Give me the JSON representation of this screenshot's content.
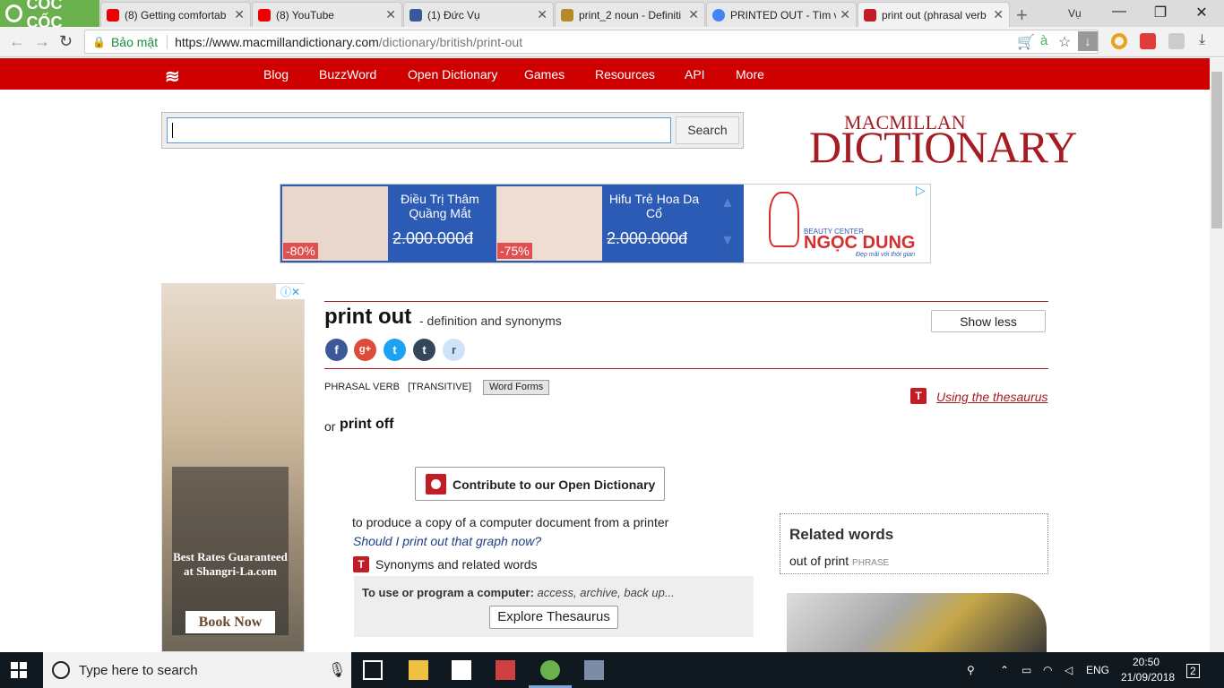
{
  "browser": {
    "brand": "CỐC CỐC",
    "tabs": [
      {
        "title": "(8) Getting comfortab",
        "favicon": "youtube-icon"
      },
      {
        "title": "(8) YouTube",
        "favicon": "youtube-icon"
      },
      {
        "title": "(1) Đức Vụ",
        "favicon": "facebook-icon"
      },
      {
        "title": "print_2 noun - Definiti",
        "favicon": "dictionary-icon"
      },
      {
        "title": "PRINTED OUT - Tìm vớ",
        "favicon": "google-icon"
      },
      {
        "title": "print out (phrasal verb",
        "favicon": "macmillan-icon"
      }
    ],
    "profile": "Vụ",
    "secure_label": "Bảo mật",
    "url_host": "https://www.macmillandictionary.com",
    "url_path": "/dictionary/british/print-out"
  },
  "site": {
    "nav": [
      "Blog",
      "BuzzWord",
      "Open Dictionary",
      "Games",
      "Resources",
      "API",
      "More"
    ],
    "search_button": "Search",
    "logo_top": "MACMILLAN",
    "logo_bottom": "DICTIONARY"
  },
  "ad_banner": {
    "items": [
      {
        "text": "Điều Trị Thâm Quầng Mắt",
        "price": "2.000.000đ",
        "discount": "-80%"
      },
      {
        "text": "Hifu Trẻ Hoa Da Cổ",
        "price": "2.000.000đ",
        "discount": "-75%"
      }
    ],
    "brand_small": "BEAUTY CENTER",
    "brand": "NGỌC DUNG",
    "brand_tagline": "Đẹp mãi với thời gian"
  },
  "left_ad": {
    "headline": "Best Rates Guaranteed at Shangri-La.com",
    "button": "Book Now"
  },
  "entry": {
    "headword": "print out",
    "subtitle": "- definition and synonyms",
    "show_less": "Show less",
    "social": [
      "f",
      "g+",
      "t",
      "t",
      "r"
    ],
    "pos": "PHRASAL VERB",
    "grammar": "[TRANSITIVE]",
    "word_forms": "Word Forms",
    "thesaurus_link": "Using the thesaurus",
    "or_label": "or",
    "variant": "print off",
    "contribute": "Contribute to our Open Dictionary",
    "definition": "to produce a copy of a computer document from a printer",
    "example": "Should I print out that graph now?",
    "synonyms_label": "Synonyms and related words",
    "thesaurus_category": "To use or program a computer:",
    "thesaurus_words": "access, archive, back up...",
    "explore_button": "Explore Thesaurus"
  },
  "related": {
    "heading": "Related words",
    "word": "out of print",
    "word_pos": "PHRASE"
  },
  "taskbar": {
    "search_placeholder": "Type here to search",
    "lang": "ENG",
    "time": "20:50",
    "date": "21/09/2018",
    "notifications": "2"
  },
  "colors": {
    "brand_red": "#cf0000",
    "macmillan_red": "#a51c22",
    "coccoc_green": "#6ab04c",
    "ad_blue": "#2c5bb5"
  }
}
